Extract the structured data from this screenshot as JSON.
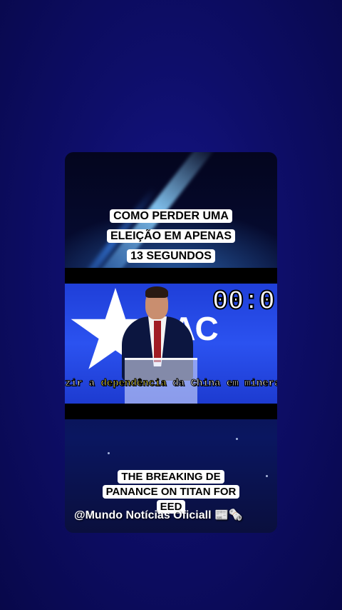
{
  "overlay_top": {
    "line1": "COMO PERDER UMA",
    "line2": "ELEIÇÃO EM APENAS",
    "line3": "13 SEGUNDOS"
  },
  "video": {
    "logo_text": "CAC",
    "timer": "00:0",
    "subtitle_pre": "zir a ",
    "subtitle_highlight": "dependência",
    "subtitle_post": " da China em minerai"
  },
  "overlay_bottom": {
    "line1": "THE BREAKING DE",
    "line2": "PANANCE ON TITAN FOR",
    "line3": "EED"
  },
  "handle": "@Mundo Notícias Oficiall 📰🗞️",
  "colors": {
    "background": "#0e0e6a",
    "video_blue": "#2b52f0",
    "highlight": "#f2e24a"
  }
}
